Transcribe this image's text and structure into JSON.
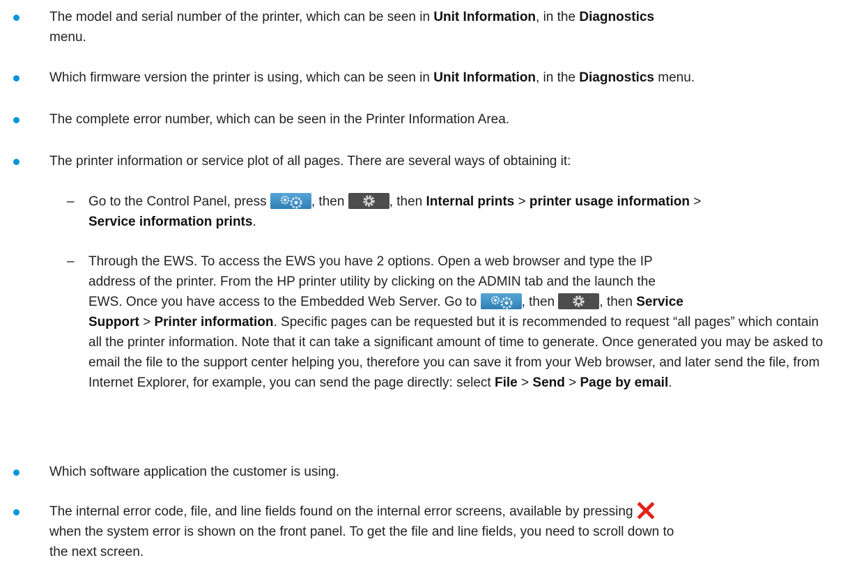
{
  "items": [
    {
      "pre": "The model and serial number of the printer, which can be seen in ",
      "b1": "Unit Information",
      "mid": ", in the ",
      "b2": "Diagnostics",
      "post": " menu."
    },
    {
      "pre": "Which firmware version the printer is using, which can be seen in ",
      "b1": "Unit Information",
      "mid": ", in the ",
      "b2": "Diagnostics",
      "post": " menu."
    },
    {
      "text": "The complete error number, which can be seen in the Printer Information Area."
    },
    {
      "text": "The printer information or service plot of all pages. There are several ways of obtaining it:"
    }
  ],
  "sub": {
    "first": {
      "pre": "Go to the Control Panel, press ",
      "then1": ", then ",
      "then2": ", then ",
      "b1": "Internal prints",
      "sep1": " > ",
      "b2": "printer usage information",
      "sep2": " >",
      "b3": "Service information prints",
      "end": "."
    },
    "second": {
      "line1": "Through the EWS. To access the EWS you have 2 options. Open a web browser and type the IP",
      "line2": "address of the printer. From the HP printer utility by clicking on the ADMIN tab and the launch the",
      "line3_pre": "EWS. Once you have access to the Embedded Web Server. Go to ",
      "then1": ", then ",
      "then2": ", then ",
      "b1": "Service",
      "b2": "Support",
      "sep1": " > ",
      "b3": "Printer information",
      "rest": ". Specific pages can be requested but it is recommended to request “all pages” which contain all the printer information. Note that it can take a significant amount of time to generate. Once generated you may be asked to email the file to the support center helping you, therefore you can save it from your Web browser, and later send the file, from Internet Explorer, for example, you can send the page directly: select ",
      "b4": "File",
      "sep2": " > ",
      "b5": "Send",
      "sep3": " > ",
      "b6": "Page by email",
      "end": "."
    }
  },
  "item5": "Which software application the customer is using.",
  "item6": {
    "line1": "The internal error code, file, and line fields found on the internal error screens, available by pressing ",
    "line2": "when the system error is shown on the front panel. To get the file and line fields, you need to scroll down to",
    "line3": "the next screen."
  },
  "icons": {
    "settings": "settings-gears-icon",
    "gear": "gear-icon",
    "close": "close-x-icon"
  },
  "colors": {
    "bullet": "#0096d6",
    "close_x": "#e2231a"
  }
}
